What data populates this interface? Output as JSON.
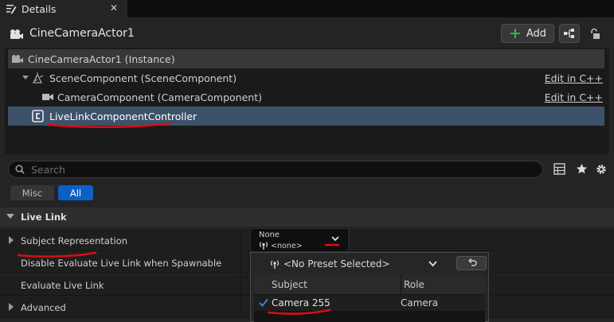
{
  "tab": {
    "title": "Details",
    "close_glyph": "✕",
    "icon": "details-pencil-icon"
  },
  "actor": {
    "name": "CineCameraActor1",
    "icon": "camera-actor-icon"
  },
  "toolbar": {
    "add_label": "Add",
    "add_icon": "plus-icon",
    "blueprint_icon": "blueprint-icon",
    "lock_icon": "lock-icon"
  },
  "components": [
    {
      "label": "CineCameraActor1 (Instance)",
      "icon": "actor-icon"
    },
    {
      "label": "SceneComponent (SceneComponent)",
      "icon": "scene-component-icon",
      "edit": "Edit in C++",
      "expanded": true
    },
    {
      "label": "CameraComponent (CameraComponent)",
      "icon": "camera-icon",
      "edit": "Edit in C++"
    },
    {
      "label": "LiveLinkComponentController",
      "icon": "cpp-component-icon",
      "selected": true
    }
  ],
  "search": {
    "placeholder": "Search"
  },
  "filters": {
    "misc": "Misc",
    "all": "All",
    "active": "all"
  },
  "section": {
    "title": "Live Link",
    "expanded": true
  },
  "properties": [
    {
      "name": "Subject Representation",
      "expandable": true
    },
    {
      "name": "Disable Evaluate Live Link when Spawnable"
    },
    {
      "name": "Evaluate Live Link"
    },
    {
      "name": "Advanced",
      "expandable": true
    }
  ],
  "subject_combo": {
    "value_top": "None",
    "value_bottom": "<none>"
  },
  "preset_popup": {
    "preset_label": "<No Preset Selected>",
    "columns": [
      "Subject",
      "Role"
    ],
    "rows": [
      {
        "subject": "Camera 255",
        "role": "Camera",
        "checked": true
      }
    ]
  },
  "colors": {
    "accent": "#0a60c8",
    "selected_row": "#3d526a",
    "annotation": "#d80e17",
    "add_green": "#2fb344"
  }
}
